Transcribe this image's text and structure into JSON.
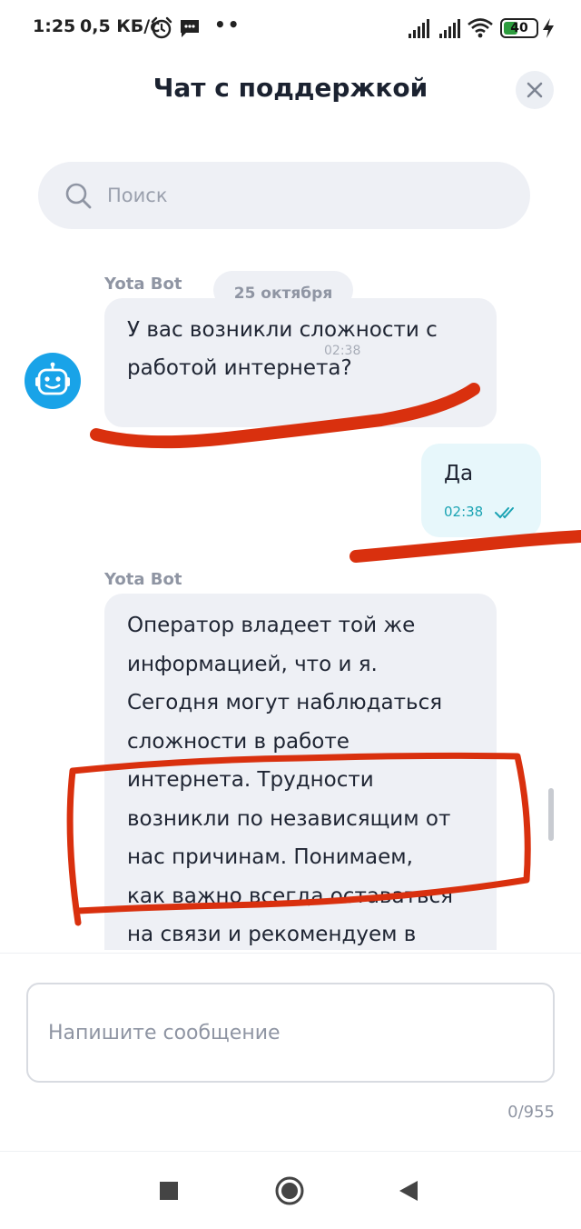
{
  "status_bar": {
    "time": "1:25",
    "speed": "0,5 КБ/с",
    "dots": "••",
    "battery": "40",
    "icons": [
      "alarm-icon",
      "message-icon",
      "signal-icon",
      "signal-icon",
      "wifi-icon",
      "battery-icon",
      "charging-icon"
    ]
  },
  "header": {
    "title": "Чат с поддержкой",
    "close_icon": "close-icon"
  },
  "search": {
    "placeholder": "Поиск",
    "icon": "search-icon"
  },
  "chat": {
    "date_label": "25 октября",
    "messages": [
      {
        "sender": "Yota Bot",
        "lines": [
          "У вас возникли сложности с",
          "работой интернета?"
        ],
        "time": "02:38"
      },
      {
        "sender": "user",
        "text": "Да",
        "time": "02:38",
        "status_icon": "double-check-icon"
      },
      {
        "sender": "Yota Bot",
        "lines": [
          "Оператор владеет той же",
          "информацией, что и я.",
          "Сегодня могут наблюдаться",
          "сложности в работе",
          "интернета. Трудности",
          "возникли по независящим от",
          "нас причинам. Понимаем,",
          "как важно всегда оставаться",
          "на связи и рекомендуем в"
        ]
      }
    ]
  },
  "composer": {
    "placeholder": "Напишите сообщение",
    "counter": "0/955"
  },
  "nav": {
    "icons": [
      "recents-square-icon",
      "home-circle-icon",
      "back-triangle-icon"
    ]
  },
  "colors": {
    "bot_bubble": "#eef0f5",
    "user_bubble": "#e7f7fb",
    "avatar": "#19a3e8",
    "time_accent": "#1aa3b3",
    "annotation": "#d9300e"
  }
}
